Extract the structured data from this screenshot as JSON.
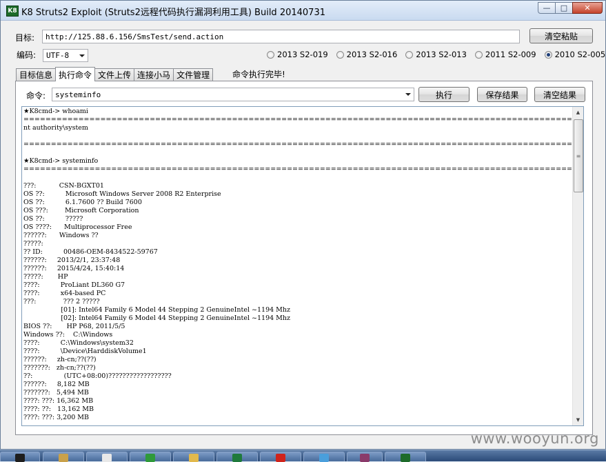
{
  "window": {
    "title": "K8 Struts2 Exploit (Struts2远程代码执行漏洞利用工具)  Build 20140731",
    "icon_text": "K8",
    "controls": {
      "minimize": "—",
      "maximize": "□",
      "close": "✕"
    }
  },
  "form": {
    "target_label": "目标:",
    "target_value": "http://125.88.6.156/SmsTest/send.action",
    "clear_paste_button": "清空粘贴",
    "encoding_label": "编码:",
    "encoding_value": "UTF-8"
  },
  "exploits": [
    {
      "label": "2013 S2-019",
      "checked": false
    },
    {
      "label": "2013 S2-016",
      "checked": false
    },
    {
      "label": "2013 S2-013",
      "checked": false
    },
    {
      "label": "2011 S2-009",
      "checked": false
    },
    {
      "label": "2010 S2-005",
      "checked": true
    }
  ],
  "tabs": [
    {
      "label": "目标信息",
      "active": false
    },
    {
      "label": "执行命令",
      "active": true
    },
    {
      "label": "文件上传",
      "active": false
    },
    {
      "label": "连接小马",
      "active": false
    },
    {
      "label": "文件管理",
      "active": false
    }
  ],
  "status": "命令执行完毕!",
  "command": {
    "label": "命令:",
    "value": "systeminfo",
    "execute_button": "执行",
    "save_button": "保存结果",
    "clear_button": "清空结果"
  },
  "output_text": "★K8cmd-> whoami\n=============================================================================================================\nnt authority\\system\n\n=============================================================================================================\n\n★K8cmd-> systeminfo\n=============================================================================================================\n\n???:           CSN-BGXT01\nOS ??:          Microsoft Windows Server 2008 R2 Enterprise\nOS ??:          6.1.7600 ?? Build 7600\nOS ???:        Microsoft Corporation\nOS ??:          ?????\nOS ????:      Multiprocessor Free\n??????:      Windows ??\n?????:\n?? ID:          00486-OEM-8434522-59767\n??????:     2013/2/1, 23:37:48\n??????:     2015/4/24, 15:40:14\n?????:       HP\n????:          ProLiant DL360 G7\n????:          x64-based PC\n???:             ??? 2 ?????\n                  [01]: Intel64 Family 6 Model 44 Stepping 2 GenuineIntel ~1194 Mhz\n                  [02]: Intel64 Family 6 Model 44 Stepping 2 GenuineIntel ~1194 Mhz\nBIOS ??:       HP P68, 2011/5/5\nWindows ??:    C:\\Windows\n????:          C:\\Windows\\system32\n????:          \\Device\\HarddiskVolume1\n??????:     zh-cn;??(??)\n???????:   zh-cn;??(??)\n??:               (UTC+08:00)??????????????????\n??????:     8,182 MB\n???????:   5,494 MB\n????: ???: 16,362 MB\n????: ??:   13,162 MB\n????: ???: 3,200 MB",
  "watermark": "www.wooyun.org",
  "taskbar": {
    "items": [
      {
        "icon": "console-icon",
        "color": "#1e1e1e"
      },
      {
        "icon": "explorer-icon",
        "color": "#c9a14a"
      },
      {
        "icon": "notepad-icon",
        "color": "#e8e8e8"
      },
      {
        "icon": "green-arrow-icon",
        "color": "#2f9a3a"
      },
      {
        "icon": "folder-icon",
        "color": "#e2b94c"
      },
      {
        "icon": "spreadsheet-icon",
        "color": "#1f7a3c"
      },
      {
        "icon": "red-circle-icon",
        "color": "#d0241c"
      },
      {
        "icon": "browser-icon",
        "color": "#4a9fdc"
      },
      {
        "icon": "media-icon",
        "color": "#8a3a6a"
      },
      {
        "icon": "k8-tool-icon",
        "color": "#1d6b2a"
      }
    ]
  }
}
